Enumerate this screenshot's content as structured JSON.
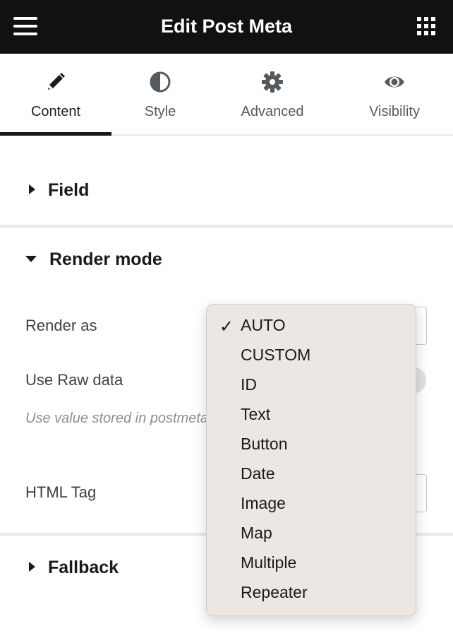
{
  "header": {
    "title": "Edit Post Meta",
    "menu_icon": "hamburger-icon",
    "apps_icon": "grid-icon"
  },
  "tabs": [
    {
      "label": "Content",
      "icon": "pencil-icon",
      "active": true
    },
    {
      "label": "Style",
      "icon": "half-circle-icon",
      "active": false
    },
    {
      "label": "Advanced",
      "icon": "gear-icon",
      "active": false
    },
    {
      "label": "Visibility",
      "icon": "eye-icon",
      "active": false
    }
  ],
  "sections": {
    "field": {
      "title": "Field",
      "expanded": false
    },
    "render_mode": {
      "title": "Render mode",
      "expanded": true,
      "render_as_label": "Render as",
      "raw_data_label": "Use Raw data",
      "raw_data_hint": "Use value stored in postmeta without any modification.",
      "html_tag_label": "HTML Tag"
    },
    "fallback": {
      "title": "Fallback",
      "expanded": false
    }
  },
  "dropdown": {
    "check_mark": "✓",
    "selected": "AUTO",
    "options": [
      "AUTO",
      "CUSTOM",
      "ID",
      "Text",
      "Button",
      "Date",
      "Image",
      "Map",
      "Multiple",
      "Repeater"
    ]
  },
  "colors": {
    "header_bg": "#111111",
    "dropdown_bg": "#ece7e3",
    "separator": "#e6e8ea"
  }
}
